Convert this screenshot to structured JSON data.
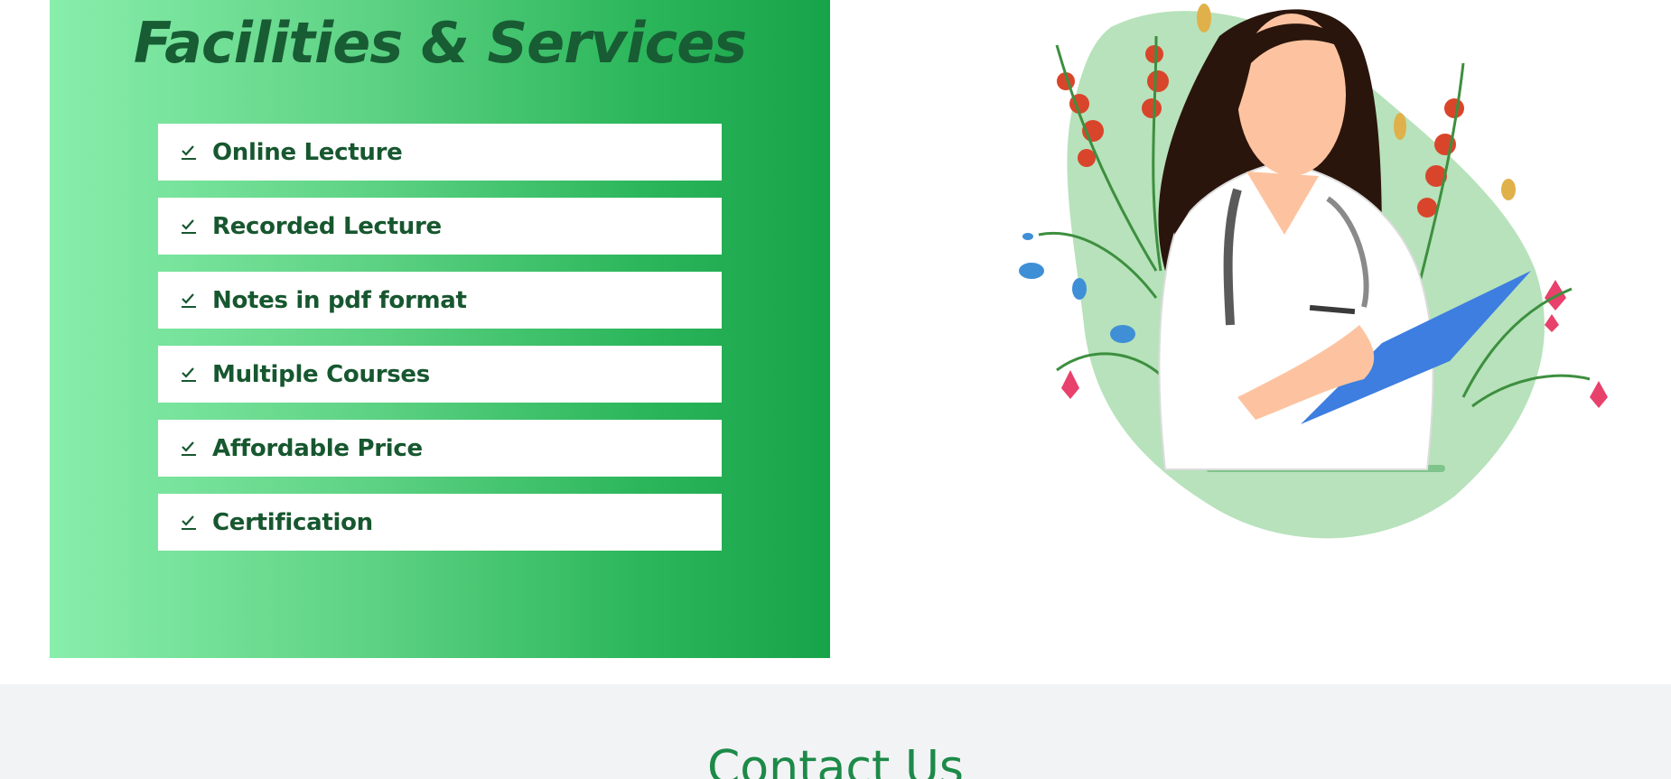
{
  "facilities": {
    "title": "Facilities & Services",
    "items": [
      {
        "label": "Online Lecture",
        "icon": "check-icon"
      },
      {
        "label": "Recorded Lecture",
        "icon": "check-icon"
      },
      {
        "label": "Notes in pdf format",
        "icon": "check-icon"
      },
      {
        "label": "Multiple Courses",
        "icon": "check-icon"
      },
      {
        "label": "Affordable Price",
        "icon": "check-icon"
      },
      {
        "label": "Certification",
        "icon": "check-icon"
      }
    ]
  },
  "illustration": {
    "name": "doctor-illustration"
  },
  "contact": {
    "title": "Contact Us"
  },
  "colors": {
    "accent_dark_green": "#185c34",
    "gradient_start": "#88eeab",
    "gradient_end": "#17a349",
    "contact_title": "#1c8a48",
    "contact_bg": "#f2f3f5"
  }
}
